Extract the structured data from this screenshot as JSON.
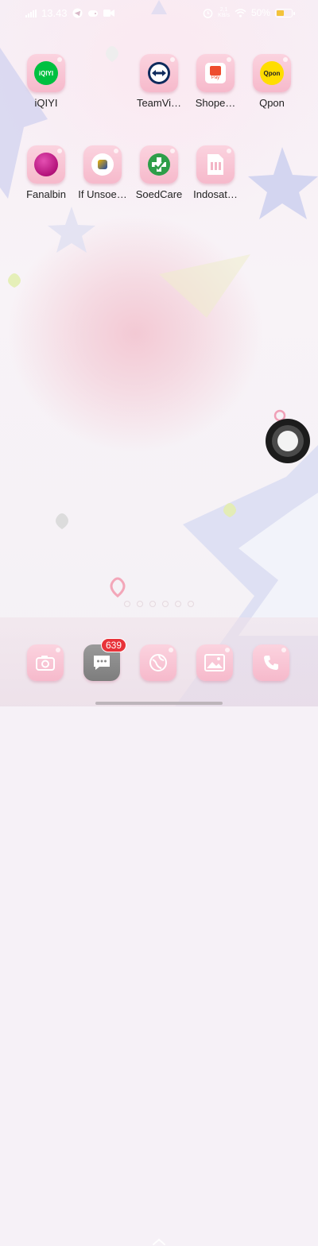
{
  "status_bar": {
    "time": "13.43",
    "network_speed_top": "2,1",
    "network_speed_bottom": "KB/s",
    "battery_percent": "50%",
    "battery_level": 0.5,
    "icons": [
      "signal-icon",
      "telegram-icon",
      "game-controller-icon",
      "video-camera-icon",
      "alarm-icon",
      "wifi-icon",
      "battery-icon"
    ]
  },
  "home": {
    "apps": [
      {
        "label": "iQIYI",
        "icon": "iqiyi-icon",
        "icon_text": "iQIYI",
        "accent": "#00c040"
      },
      {
        "label": "TeamVi…",
        "icon": "teamviewer-icon",
        "accent": "#0e2a5c"
      },
      {
        "label": "Shope…",
        "icon": "shopeepay-icon",
        "icon_text": "Pay",
        "accent": "#ee4d2d"
      },
      {
        "label": "Qpon",
        "icon": "qpon-icon",
        "icon_text": "Qpon",
        "accent": "#ffdd00"
      },
      {
        "label": "Fanalbin",
        "icon": "fanalbin-icon",
        "accent": "#c2177f"
      },
      {
        "label": "If Unsoe…",
        "icon": "if-unsoed-icon",
        "accent": "#f0b400"
      },
      {
        "label": "SoedCare",
        "icon": "soedcare-icon",
        "accent": "#2e9e49"
      },
      {
        "label": "Indosat…",
        "icon": "indosat-icon",
        "accent": "#ffffff"
      }
    ],
    "page_indicator": {
      "count": 6
    }
  },
  "dock": {
    "apps": [
      {
        "name": "Camera",
        "icon": "camera-icon"
      },
      {
        "name": "Messages",
        "icon": "messages-icon",
        "badge": "639"
      },
      {
        "name": "Browser",
        "icon": "browser-globe-icon"
      },
      {
        "name": "Gallery",
        "icon": "gallery-icon"
      },
      {
        "name": "Phone",
        "icon": "phone-icon"
      }
    ]
  },
  "assistive_touch": {
    "icon": "assistive-touch-icon"
  }
}
